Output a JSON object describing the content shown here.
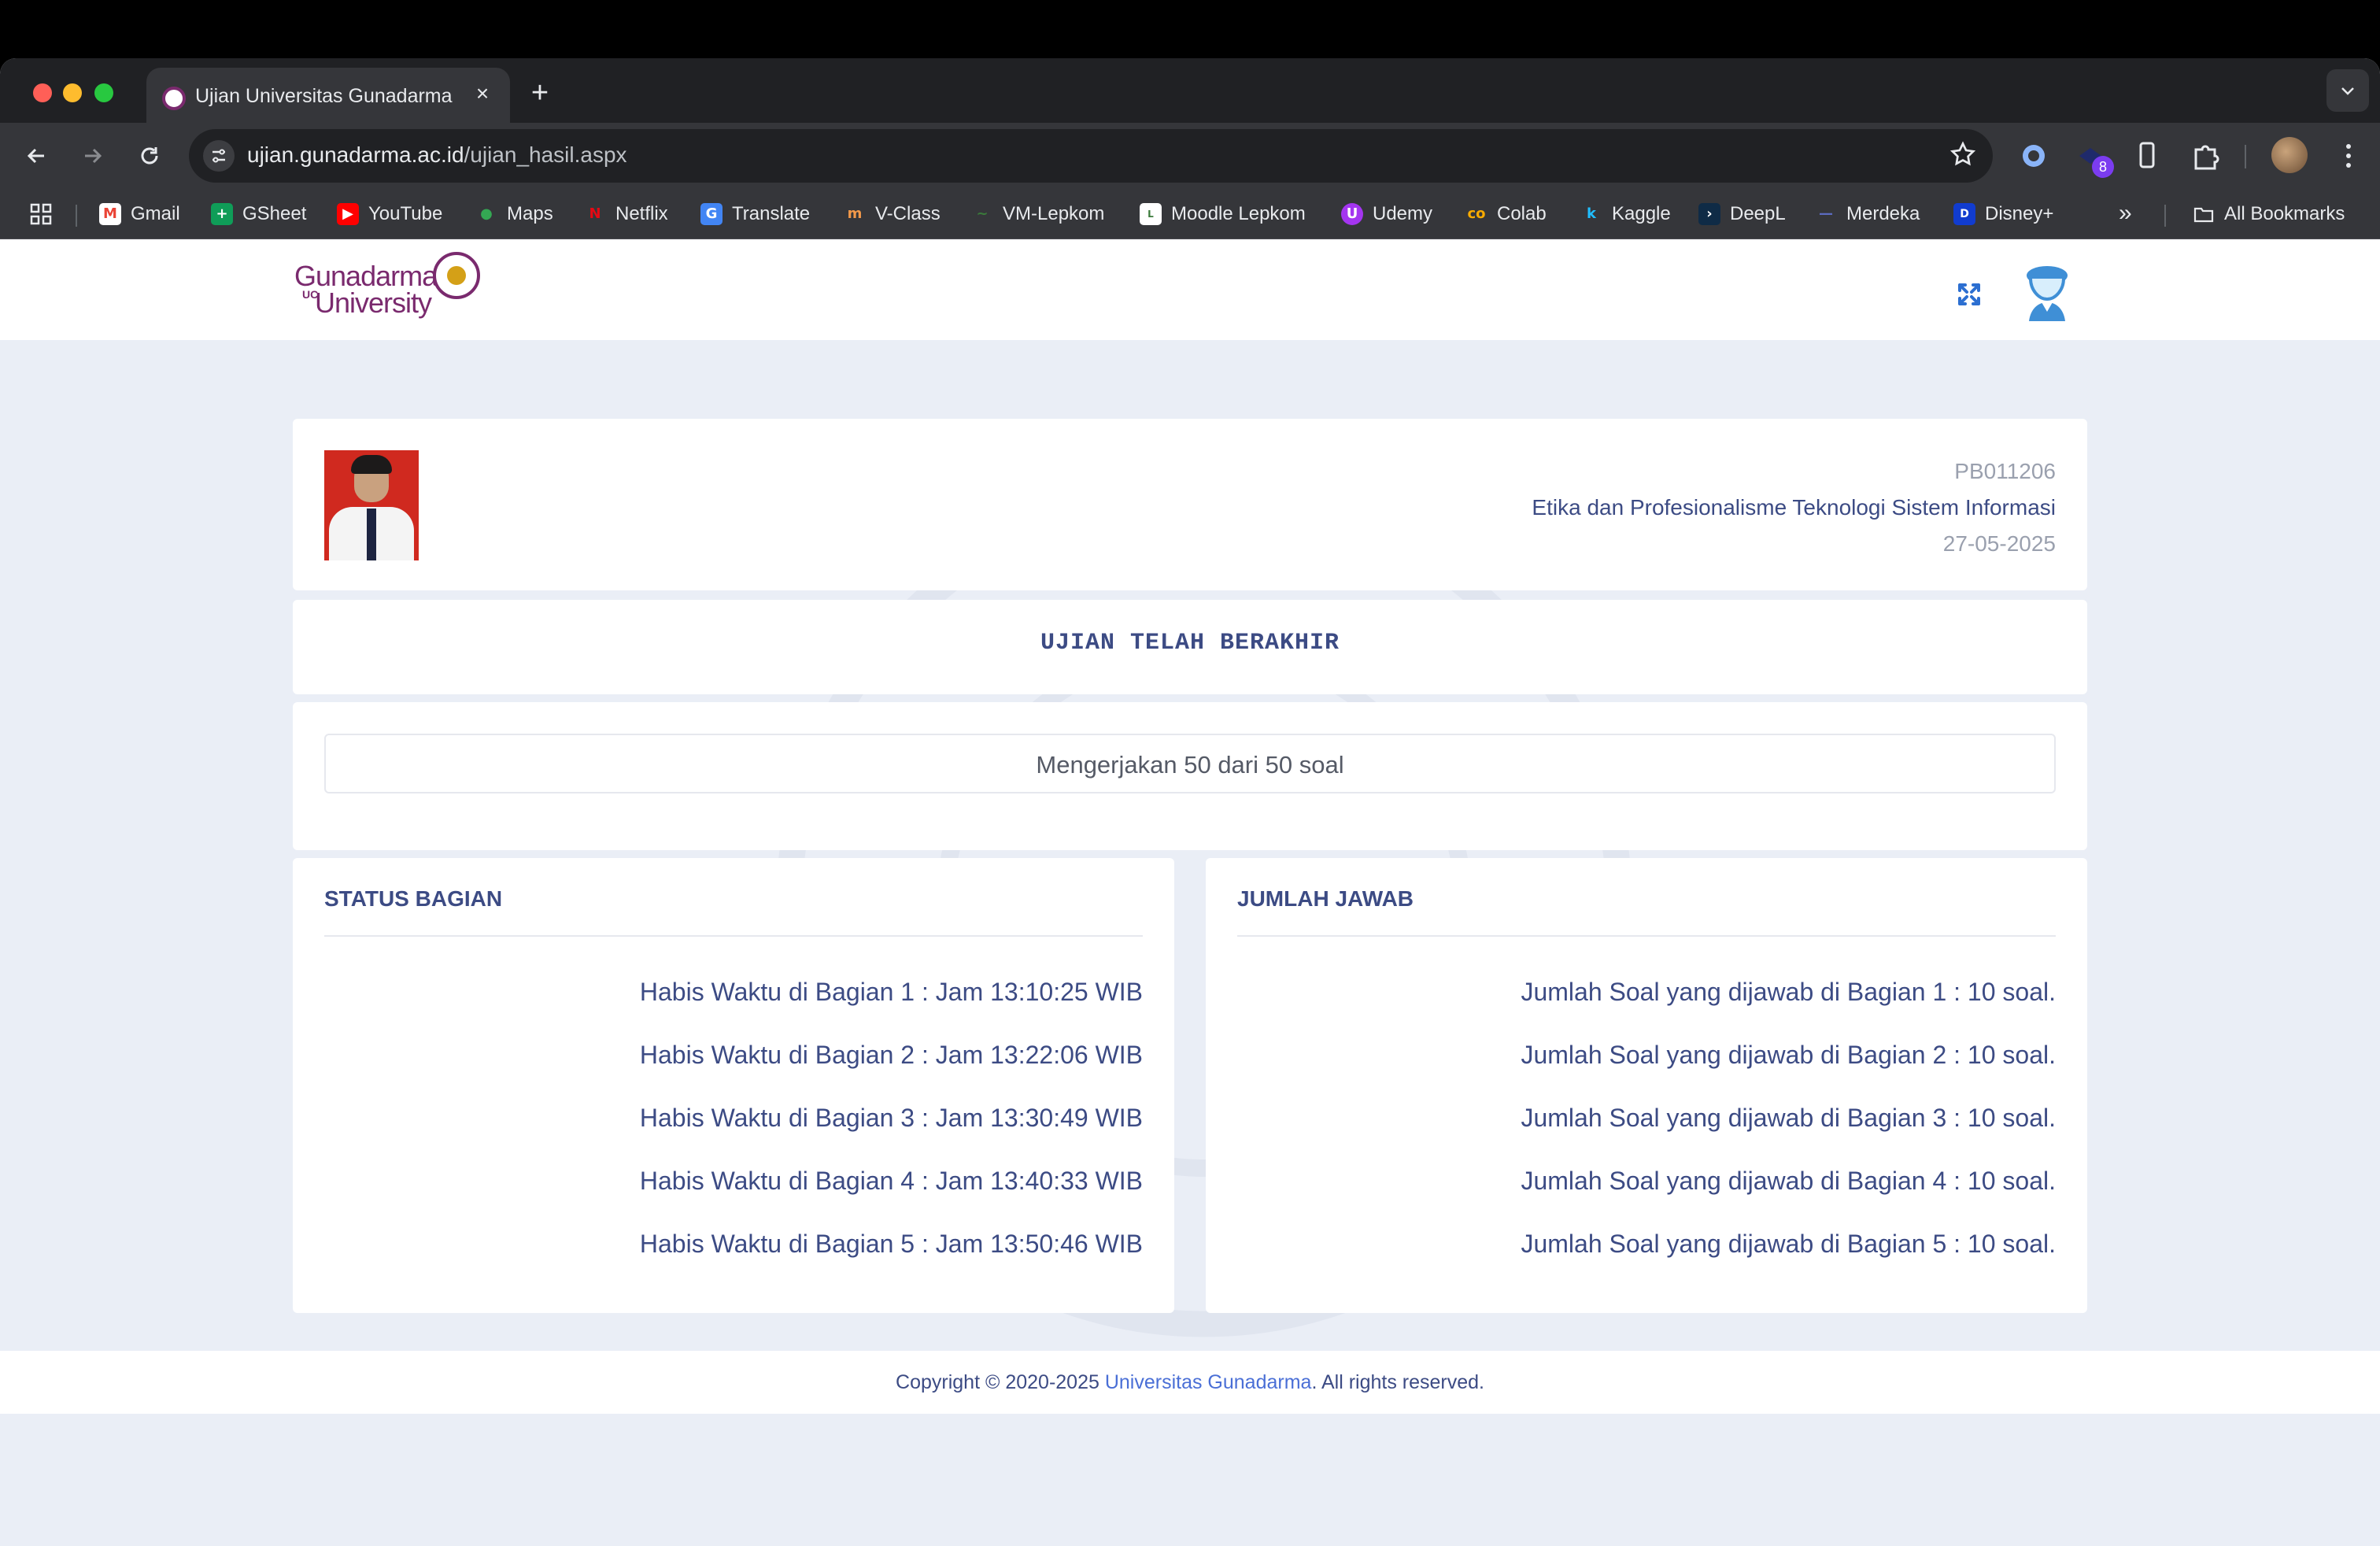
{
  "browser": {
    "tab_title": "Ujian Universitas Gunadarma",
    "url_domain": "ujian.gunadarma.ac.id",
    "url_path": "/ujian_hasil.aspx",
    "extension_badge": "8",
    "bookmarks": [
      "Gmail",
      "GSheet",
      "YouTube",
      "Maps",
      "Netflix",
      "Translate",
      "V-Class",
      "VM-Lepkom",
      "Moodle Lepkom",
      "Udemy",
      "Colab",
      "Kaggle",
      "DeepL",
      "Merdeka",
      "Disney+"
    ],
    "all_bookmarks": "All Bookmarks"
  },
  "logo": {
    "line1": "Gunadarma",
    "line2": "University",
    "uc": "UC"
  },
  "exam": {
    "code": "PB011206",
    "course": "Etika dan Profesionalisme Teknologi Sistem Informasi",
    "date": "27-05-2025",
    "ended_title": "UJIAN TELAH BERAKHIR",
    "progress_text": "Mengerjakan 50 dari 50 soal"
  },
  "status": {
    "heading": "STATUS BAGIAN",
    "rows": [
      "Habis Waktu di Bagian 1 : Jam 13:10:25 WIB",
      "Habis Waktu di Bagian 2 : Jam 13:22:06 WIB",
      "Habis Waktu di Bagian 3 : Jam 13:30:49 WIB",
      "Habis Waktu di Bagian 4 : Jam 13:40:33 WIB",
      "Habis Waktu di Bagian 5 : Jam 13:50:46 WIB"
    ]
  },
  "answers": {
    "heading": "JUMLAH JAWAB",
    "rows": [
      "Jumlah Soal yang dijawab di Bagian 1 : 10 soal.",
      "Jumlah Soal yang dijawab di Bagian 2 : 10 soal.",
      "Jumlah Soal yang dijawab di Bagian 3 : 10 soal.",
      "Jumlah Soal yang dijawab di Bagian 4 : 10 soal.",
      "Jumlah Soal yang dijawab di Bagian 5 : 10 soal."
    ]
  },
  "footer": {
    "prefix": "Copyright © 2020-2025 ",
    "link": "Universitas Gunadarma",
    "suffix": ". All rights reserved."
  },
  "colors": {
    "accent": "#3c4b84",
    "link": "#4a6fd6",
    "page_bg": "#eaeef6",
    "brand": "#7a2a6e"
  }
}
